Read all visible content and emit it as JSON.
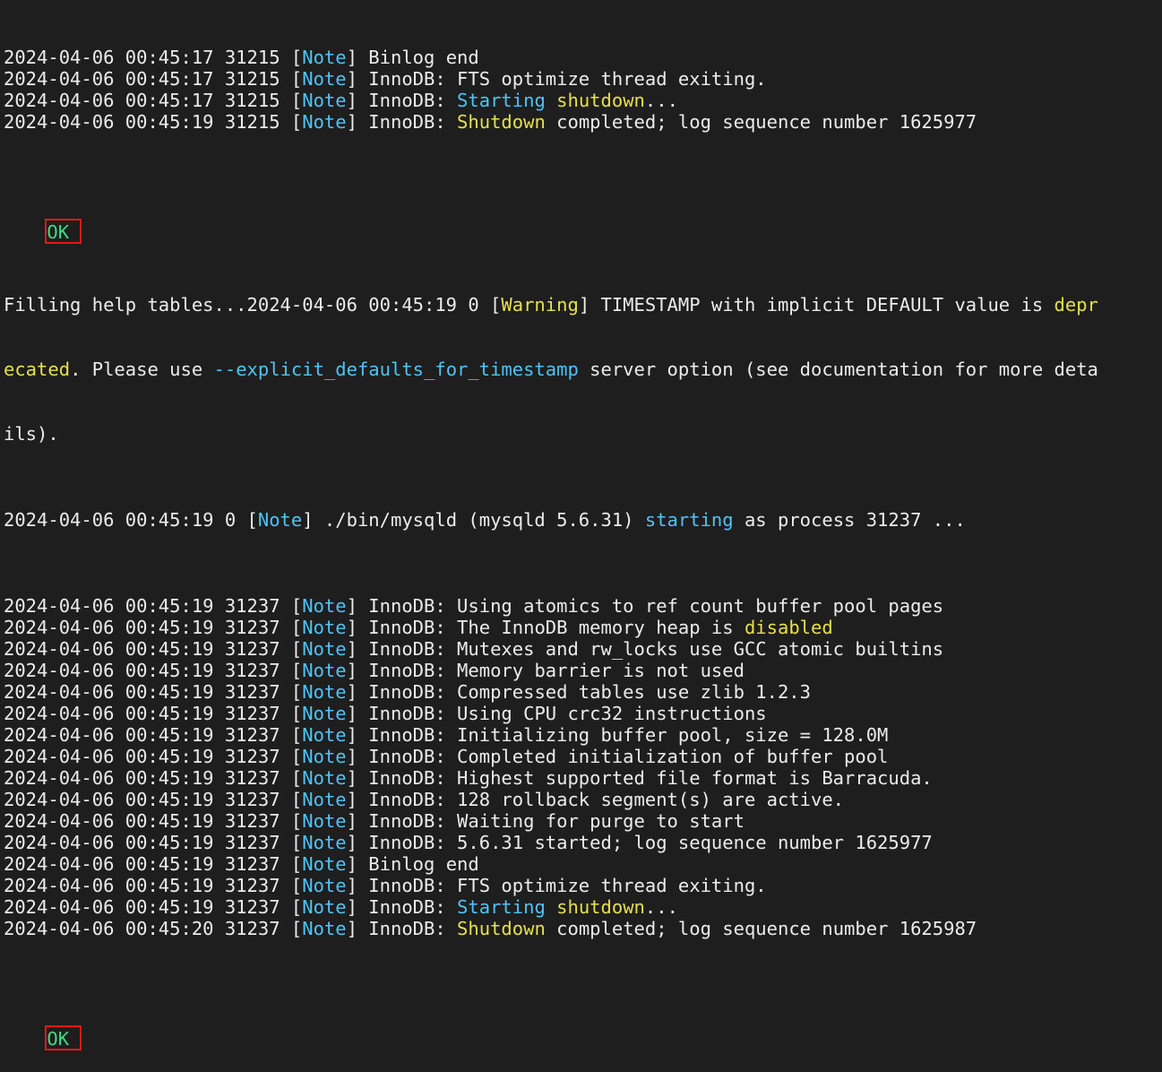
{
  "colors": {
    "background": "#1e1e1e",
    "text": "#ececec",
    "note": "#4fc3f7",
    "warning": "#e6e04a",
    "ok": "#3ddc84",
    "highlight_box": "#e01818"
  },
  "block1": [
    {
      "ts": "2024-04-06 00:45:17 31215 [",
      "tag": "Note",
      "rest_parts": [
        {
          "t": "] Binlog end",
          "c": ""
        }
      ]
    },
    {
      "ts": "2024-04-06 00:45:17 31215 [",
      "tag": "Note",
      "rest_parts": [
        {
          "t": "] InnoDB: FTS optimize thread exiting.",
          "c": ""
        }
      ]
    },
    {
      "ts": "2024-04-06 00:45:17 31215 [",
      "tag": "Note",
      "rest_parts": [
        {
          "t": "] InnoDB: ",
          "c": ""
        },
        {
          "t": "Starting",
          "c": "cyan"
        },
        {
          "t": " ",
          "c": ""
        },
        {
          "t": "shutdown",
          "c": "yellow"
        },
        {
          "t": "...",
          "c": ""
        }
      ]
    },
    {
      "ts": "2024-04-06 00:45:19 31215 [",
      "tag": "Note",
      "rest_parts": [
        {
          "t": "] InnoDB: ",
          "c": ""
        },
        {
          "t": "Shutdown",
          "c": "yellow"
        },
        {
          "t": " completed; log sequence number 1625977",
          "c": ""
        }
      ]
    }
  ],
  "ok1": "OK",
  "fill_line1_a": "Filling help tables...2024-04-06 00:45:19 0 [",
  "fill_line1_warn": "Warning",
  "fill_line1_b": "] TIMESTAMP with implicit DEFAULT value is ",
  "fill_line1_depr": "depr",
  "fill_line2_depr": "ecated",
  "fill_line2_a": ". Please use ",
  "fill_line2_opt": "--explicit_defaults_for_timestamp",
  "fill_line2_b": " server option (see documentation for more deta",
  "fill_line3": "ils).",
  "start_line_a": "2024-04-06 00:45:19 0 [",
  "start_line_tag": "Note",
  "start_line_b": "] ./bin/mysqld (mysqld 5.6.31) ",
  "start_line_starting": "starting",
  "start_line_c": " as process 31237 ...",
  "block2": [
    {
      "ts": "2024-04-06 00:45:19 31237 [",
      "tag": "Note",
      "rest_parts": [
        {
          "t": "] InnoDB: Using atomics to ref count buffer pool pages",
          "c": ""
        }
      ]
    },
    {
      "ts": "2024-04-06 00:45:19 31237 [",
      "tag": "Note",
      "rest_parts": [
        {
          "t": "] InnoDB: The InnoDB memory heap is ",
          "c": ""
        },
        {
          "t": "disabled",
          "c": "yellow"
        }
      ]
    },
    {
      "ts": "2024-04-06 00:45:19 31237 [",
      "tag": "Note",
      "rest_parts": [
        {
          "t": "] InnoDB: Mutexes and rw_locks use GCC atomic builtins",
          "c": ""
        }
      ]
    },
    {
      "ts": "2024-04-06 00:45:19 31237 [",
      "tag": "Note",
      "rest_parts": [
        {
          "t": "] InnoDB: Memory barrier is not used",
          "c": ""
        }
      ]
    },
    {
      "ts": "2024-04-06 00:45:19 31237 [",
      "tag": "Note",
      "rest_parts": [
        {
          "t": "] InnoDB: Compressed tables use zlib 1.2.3",
          "c": ""
        }
      ]
    },
    {
      "ts": "2024-04-06 00:45:19 31237 [",
      "tag": "Note",
      "rest_parts": [
        {
          "t": "] InnoDB: Using CPU crc32 instructions",
          "c": ""
        }
      ]
    },
    {
      "ts": "2024-04-06 00:45:19 31237 [",
      "tag": "Note",
      "rest_parts": [
        {
          "t": "] InnoDB: Initializing buffer pool, size = 128.0M",
          "c": ""
        }
      ]
    },
    {
      "ts": "2024-04-06 00:45:19 31237 [",
      "tag": "Note",
      "rest_parts": [
        {
          "t": "] InnoDB: Completed initialization of buffer pool",
          "c": ""
        }
      ]
    },
    {
      "ts": "2024-04-06 00:45:19 31237 [",
      "tag": "Note",
      "rest_parts": [
        {
          "t": "] InnoDB: Highest supported file format is Barracuda.",
          "c": ""
        }
      ]
    },
    {
      "ts": "2024-04-06 00:45:19 31237 [",
      "tag": "Note",
      "rest_parts": [
        {
          "t": "] InnoDB: 128 rollback segment(s) are active.",
          "c": ""
        }
      ]
    },
    {
      "ts": "2024-04-06 00:45:19 31237 [",
      "tag": "Note",
      "rest_parts": [
        {
          "t": "] InnoDB: Waiting for purge to start",
          "c": ""
        }
      ]
    },
    {
      "ts": "2024-04-06 00:45:19 31237 [",
      "tag": "Note",
      "rest_parts": [
        {
          "t": "] InnoDB: 5.6.31 started; log sequence number 1625977",
          "c": ""
        }
      ]
    },
    {
      "ts": "2024-04-06 00:45:19 31237 [",
      "tag": "Note",
      "rest_parts": [
        {
          "t": "] Binlog end",
          "c": ""
        }
      ]
    },
    {
      "ts": "2024-04-06 00:45:19 31237 [",
      "tag": "Note",
      "rest_parts": [
        {
          "t": "] InnoDB: FTS optimize thread exiting.",
          "c": ""
        }
      ]
    },
    {
      "ts": "2024-04-06 00:45:19 31237 [",
      "tag": "Note",
      "rest_parts": [
        {
          "t": "] InnoDB: ",
          "c": ""
        },
        {
          "t": "Starting",
          "c": "cyan"
        },
        {
          "t": " ",
          "c": ""
        },
        {
          "t": "shutdown",
          "c": "yellow"
        },
        {
          "t": "...",
          "c": ""
        }
      ]
    },
    {
      "ts": "2024-04-06 00:45:20 31237 [",
      "tag": "Note",
      "rest_parts": [
        {
          "t": "] InnoDB: ",
          "c": ""
        },
        {
          "t": "Shutdown",
          "c": "yellow"
        },
        {
          "t": " completed; log sequence number 1625987",
          "c": ""
        }
      ]
    }
  ],
  "ok2": "OK"
}
